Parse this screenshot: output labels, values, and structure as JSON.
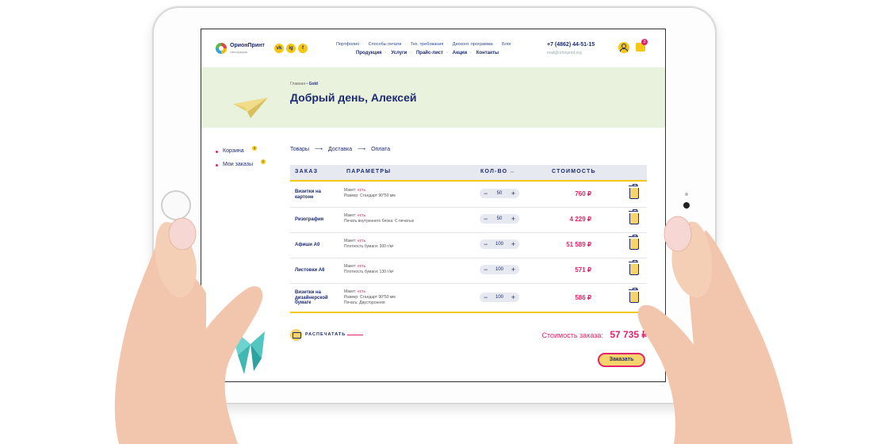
{
  "header": {
    "logo_name": "ОрионПринт",
    "logo_sub": "типография",
    "social": [
      "vk",
      "ig",
      "f"
    ],
    "nav_top": [
      "Портфолио",
      "Способы печати",
      "Тех. требования",
      "Дисконт. программа",
      "Блог"
    ],
    "nav_main": [
      "Продукция",
      "Услуги",
      "Прайс-лист",
      "Акции",
      "Контакты"
    ],
    "phone": "+7 (4862) 44-51-15",
    "email": "mail@orionprint.org",
    "cart_count": "3"
  },
  "hero": {
    "breadcrumb_home": "Главная",
    "breadcrumb_current": "Gold",
    "greeting": "Добрый день, Алексей"
  },
  "sidebar": {
    "items": [
      {
        "label": "Корзина",
        "badge": "3"
      },
      {
        "label": "Мои заказы",
        "badge": "2"
      }
    ]
  },
  "steps": [
    "Товары",
    "Доставка",
    "Оплата"
  ],
  "table": {
    "headers": {
      "order": "ЗАКАЗ",
      "params": "ПАРАМЕТРЫ",
      "qty": "КОЛ-ВО",
      "qty_unit": "шт",
      "cost": "СТОИМОСТЬ"
    },
    "rows": [
      {
        "name": "Визитки на картоне",
        "p1_label": "Макет:",
        "p1_value": "есть",
        "p2": "Размер: Стандарт 90*50 мм",
        "p3": "",
        "qty": "50",
        "price": "760 ₽"
      },
      {
        "name": "Ризография",
        "p1_label": "Макет:",
        "p1_value": "есть",
        "p2": "Печать внутреннего блока: С печатью",
        "p3": "",
        "qty": "50",
        "price": "4 229 ₽"
      },
      {
        "name": "Афиши А0",
        "p1_label": "Макет:",
        "p1_value": "есть",
        "p2": "Плотность бумаги: 300 г/м²",
        "p3": "",
        "qty": "100",
        "price": "51 589 ₽"
      },
      {
        "name": "Листовки А6",
        "p1_label": "Макет:",
        "p1_value": "есть",
        "p2": "Плотность бумаги: 130 г/м²",
        "p3": "",
        "qty": "100",
        "price": "571 ₽"
      },
      {
        "name": "Визитки на дизайнерской бумаге",
        "p1_label": "Макет:",
        "p1_value": "есть",
        "p2": "Размер: Стандарт 90*50 мм",
        "p3": "Печать: Двусторонняя",
        "qty": "100",
        "price": "586 ₽"
      }
    ]
  },
  "footer": {
    "print_label": "РАСПЕЧАТАТЬ",
    "total_label": "Стоимость заказа:",
    "total_value": "57 735 ₽",
    "order_button": "Заказать"
  },
  "colors": {
    "navy": "#1d2b73",
    "accent": "#e2226a",
    "yellow": "#f6c615",
    "hero_bg": "#e9f2dc"
  }
}
